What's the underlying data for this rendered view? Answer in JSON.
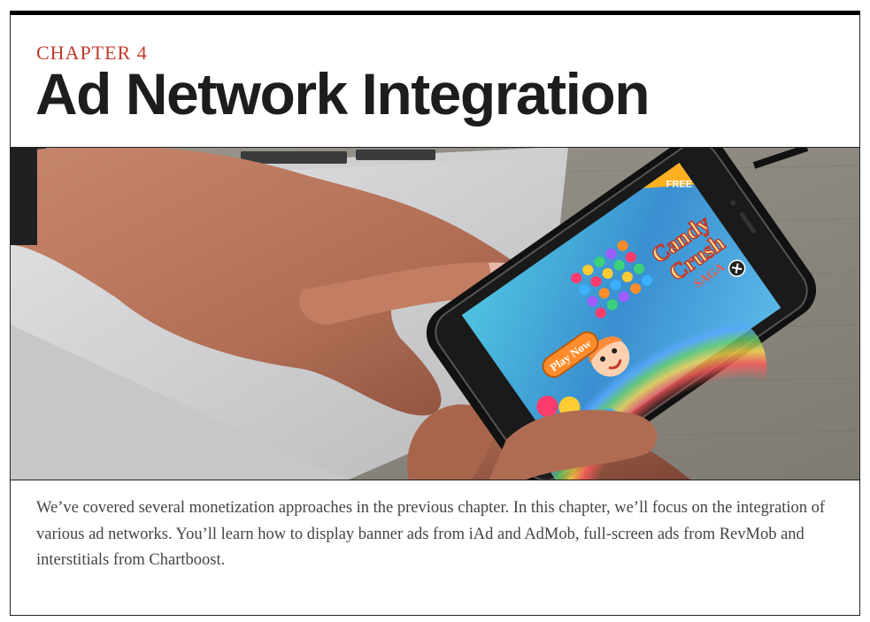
{
  "header": {
    "chapter_label": "CHAPTER 4",
    "title": "Ad Network Integration"
  },
  "hero_image": {
    "phone_screen": {
      "badge": "FREE",
      "logo_line1": "Candy",
      "logo_line2": "Crush",
      "logo_line3": "SAGA",
      "play_button": "Play Now",
      "close_icon": "close-icon"
    }
  },
  "body": {
    "intro": "We’ve covered several monetization approaches in the previous chapter. In this chapter, we’ll focus on the integration of various ad networks. You’ll learn how to display banner ads from iAd and AdMob, full-screen ads from RevMob and interstitials from Chartboost."
  },
  "colors": {
    "chapter_label": "#c0392b",
    "title": "#1d1d1d",
    "body_text": "#444444"
  }
}
